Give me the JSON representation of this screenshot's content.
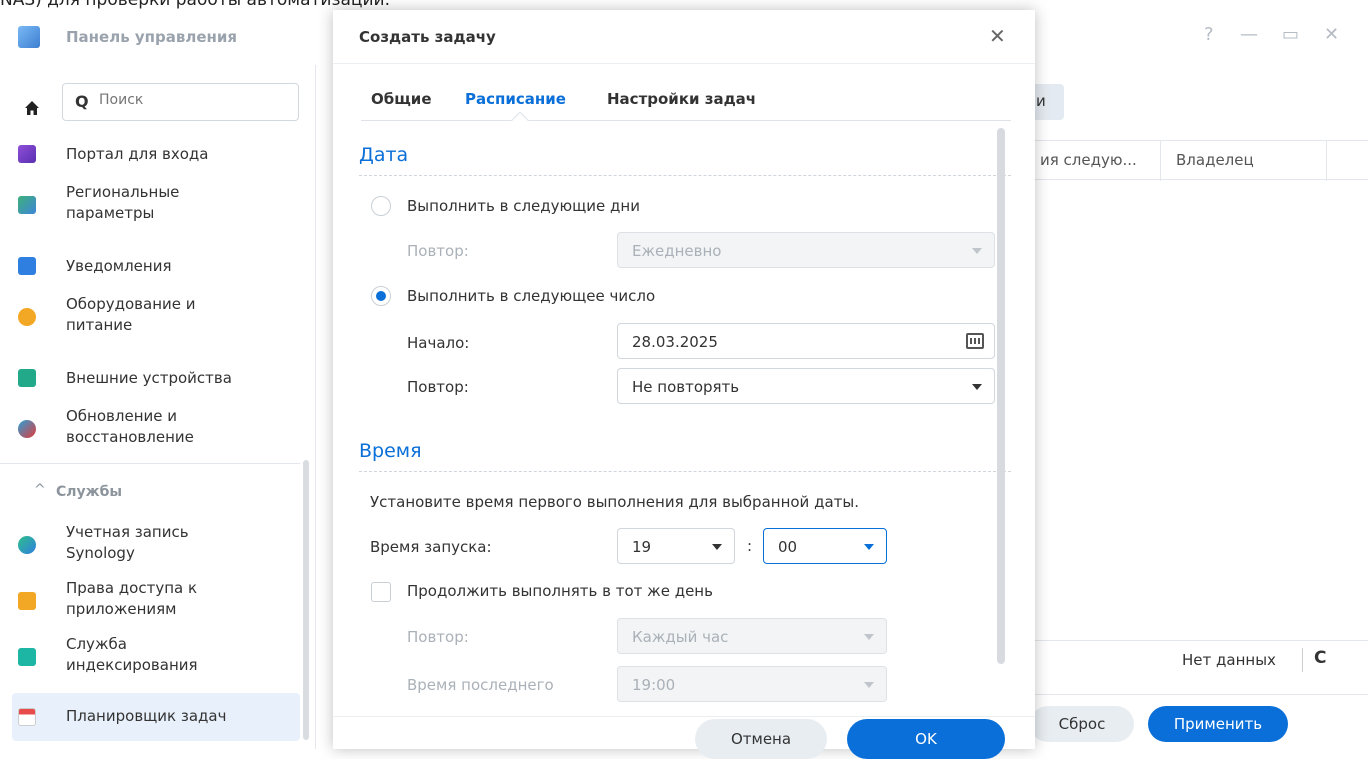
{
  "page_top_text": "NAS) для проверки работы автоматизации.",
  "control_panel": {
    "title": "Панель управления",
    "window_buttons": {
      "help": "?",
      "minimize": "—",
      "maximize": "▭",
      "close": "✕"
    },
    "search_placeholder": "Поиск",
    "sidebar_items": [
      {
        "label": "Портал для входа"
      },
      {
        "label1": "Региональные",
        "label2": "параметры"
      },
      {
        "label": "Уведомления"
      },
      {
        "label1": "Оборудование и",
        "label2": "питание"
      },
      {
        "label": "Внешние устройства"
      },
      {
        "label1": "Обновление и",
        "label2": "восстановление"
      }
    ],
    "services_header": "Службы",
    "services_items": [
      {
        "label1": "Учетная запись",
        "label2": "Synology"
      },
      {
        "label1": "Права доступа к",
        "label2": "приложениям"
      },
      {
        "label1": "Служба",
        "label2": "индексирования"
      },
      {
        "label": "Планировщик задач"
      }
    ],
    "right_button_partial": "и",
    "table_headers": [
      "ия следую...",
      "Владелец"
    ],
    "no_data": "Нет данных",
    "reset": "Сброс",
    "apply": "Применить"
  },
  "dialog": {
    "title": "Создать задачу",
    "tabs": [
      "Общие",
      "Расписание",
      "Настройки задач"
    ],
    "date_section": "Дата",
    "run_on_days": "Выполнить в следующие дни",
    "repeat_label": "Повтор:",
    "repeat_days_value": "Ежедневно",
    "run_on_date": "Выполнить в следующее число",
    "start_label": "Начало:",
    "start_value": "28.03.2025",
    "repeat_date_value": "Не повторять",
    "time_section": "Время",
    "time_hint": "Установите время первого выполнения для выбранной даты.",
    "launch_time_label": "Время запуска:",
    "hour": "19",
    "colon": ":",
    "minute": "00",
    "continue_label": "Продолжить выполнять в тот же день",
    "repeat_hourly_label": "Повтор:",
    "repeat_hourly_value": "Каждый час",
    "last_run_label": "Время последнего",
    "last_run_value": "19:00",
    "cancel": "Отмена",
    "ok": "OK"
  },
  "colors": {
    "accent": "#0a6fd8"
  }
}
